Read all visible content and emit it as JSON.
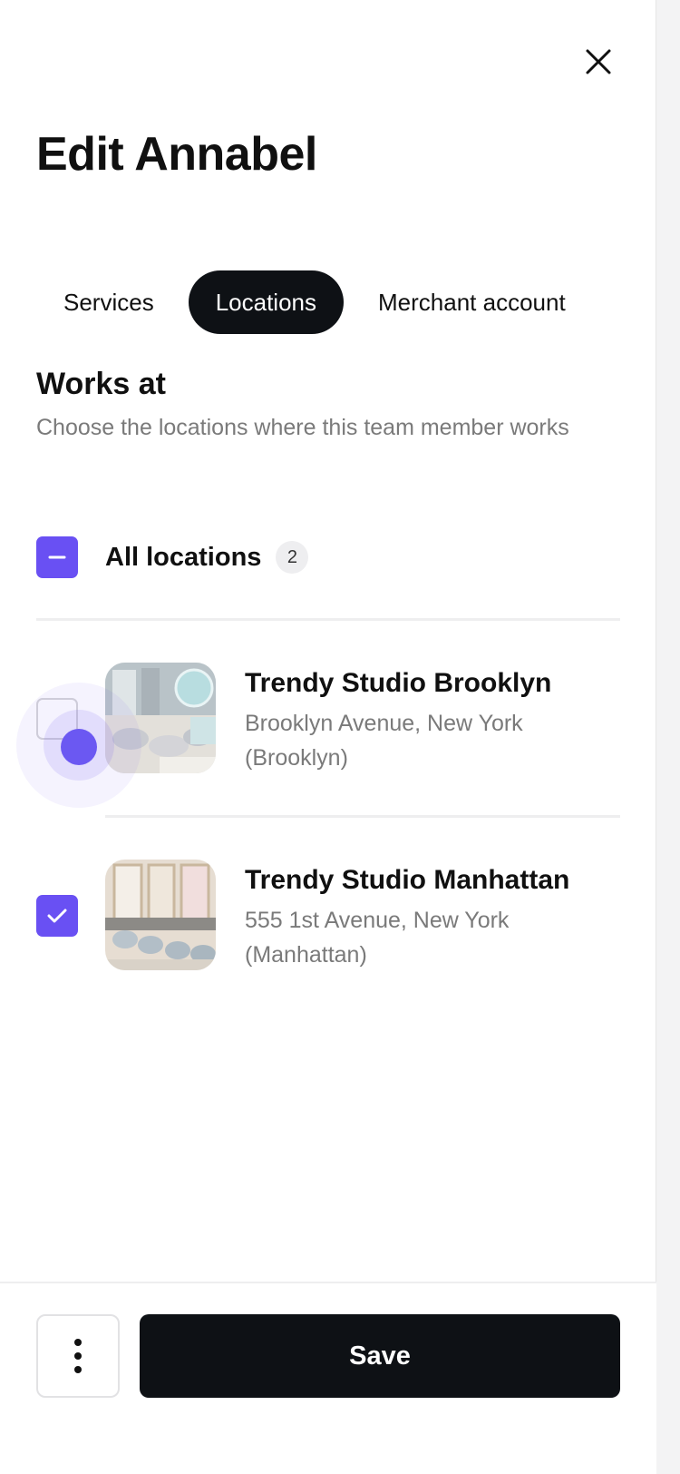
{
  "header": {
    "title": "Edit Annabel"
  },
  "tabs": [
    {
      "label": "Services",
      "active": false
    },
    {
      "label": "Locations",
      "active": true
    },
    {
      "label": "Merchant account",
      "active": false
    }
  ],
  "works_at": {
    "title": "Works at",
    "subtitle": "Choose the locations where this team member works"
  },
  "all_locations": {
    "label": "All locations",
    "count": "2",
    "state": "indeterminate"
  },
  "locations": [
    {
      "name": "Trendy Studio Brooklyn",
      "address": "Brooklyn Avenue, New York (Brooklyn)",
      "checked": false
    },
    {
      "name": "Trendy Studio Manhattan",
      "address": "555 1st Avenue, New York (Manhattan)",
      "checked": true
    }
  ],
  "footer": {
    "save_label": "Save"
  },
  "colors": {
    "accent": "#6950f3",
    "primary_dark": "#0e1115",
    "muted_text": "#7a7a7a"
  },
  "icons": {
    "close": "close-icon",
    "indeterminate": "minus-icon",
    "check": "check-icon",
    "more": "more-vertical-icon"
  }
}
